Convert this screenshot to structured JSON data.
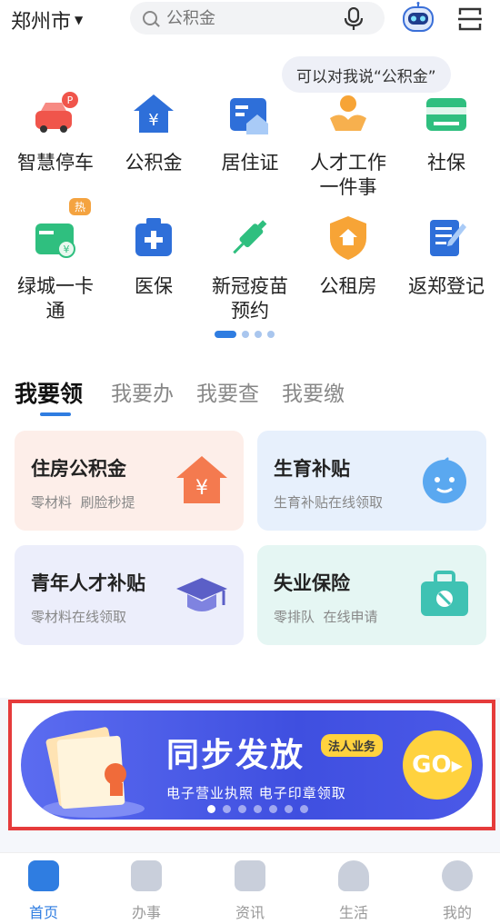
{
  "header": {
    "city": "郑州市",
    "search_placeholder": "公积金"
  },
  "assistant_tip": "可以对我说“公积金”",
  "services": [
    {
      "label": "智慧停车"
    },
    {
      "label": "公积金"
    },
    {
      "label": "居住证"
    },
    {
      "label": "人才工作\n一件事"
    },
    {
      "label": "社保"
    },
    {
      "label": "绿城一卡\n通",
      "badge": "热"
    },
    {
      "label": "医保"
    },
    {
      "label": "新冠疫苗\n预约"
    },
    {
      "label": "公租房"
    },
    {
      "label": "返郑登记"
    }
  ],
  "tabs": [
    "我要领",
    "我要办",
    "我要查",
    "我要缴"
  ],
  "cards": [
    {
      "title": "住房公积金",
      "subtitle": "零材料  刷脸秒提"
    },
    {
      "title": "生育补贴",
      "subtitle": "生育补贴在线领取"
    },
    {
      "title": "青年人才补贴",
      "subtitle": "零材料在线领取"
    },
    {
      "title": "失业保险",
      "subtitle": "零排队  在线申请"
    }
  ],
  "banner": {
    "title": "同步发放",
    "badge": "法人业务",
    "subtitle": "电子营业执照 电子印章领取",
    "go": "GO"
  },
  "nav": [
    "首页",
    "办事",
    "资讯",
    "生活",
    "我的"
  ],
  "colors": {
    "primary": "#2f7de1",
    "highlight_border": "#e53b3b",
    "banner_accent": "#ffd23e"
  }
}
